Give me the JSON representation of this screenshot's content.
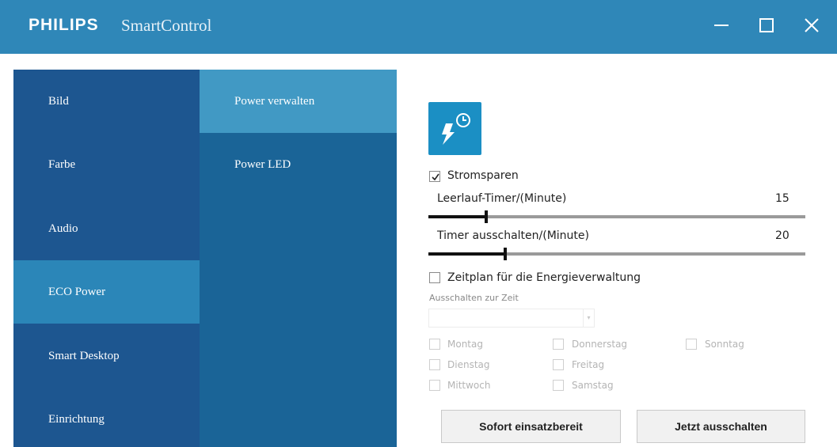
{
  "window": {
    "brand": "PHILIPS",
    "title": "SmartControl"
  },
  "nav_primary": [
    {
      "label": "Bild",
      "active": false
    },
    {
      "label": "Farbe",
      "active": false
    },
    {
      "label": "Audio",
      "active": false
    },
    {
      "label": "ECO Power",
      "active": true
    },
    {
      "label": "Smart Desktop",
      "active": false
    },
    {
      "label": "Einrichtung",
      "active": false
    }
  ],
  "nav_secondary": [
    {
      "label": "Power verwalten",
      "active": true
    },
    {
      "label": "Power LED",
      "active": false
    }
  ],
  "panel": {
    "feature_icon": "power-timer-icon",
    "power_saving": {
      "label": "Stromsparen",
      "checked": true
    },
    "idle_timer": {
      "label": "Leerlauf-Timer/(Minute)",
      "value": "15",
      "fraction": 0.153
    },
    "off_timer": {
      "label": "Timer ausschalten/(Minute)",
      "value": "20",
      "fraction": 0.203
    },
    "schedule": {
      "label": "Zeitplan für die Energieverwaltung",
      "checked": false
    },
    "off_time_label": "Ausschalten zur Zeit",
    "off_time_value": "",
    "days": [
      {
        "label": "Montag",
        "checked": false
      },
      {
        "label": "Dienstag",
        "checked": false
      },
      {
        "label": "Mittwoch",
        "checked": false
      },
      {
        "label": "Donnerstag",
        "checked": false
      },
      {
        "label": "Freitag",
        "checked": false
      },
      {
        "label": "Samstag",
        "checked": false
      },
      {
        "label": "Sonntag",
        "checked": false
      }
    ],
    "buttons": {
      "ready": "Sofort einsatzbereit",
      "shutdown": "Jetzt ausschalten"
    }
  },
  "colors": {
    "titlebar": "#2f87b8",
    "nav_primary_bg": "#1d5690",
    "nav_primary_active": "#2b86b8",
    "nav_secondary_bg": "#1a6497",
    "nav_secondary_active": "#4199c4",
    "icon_bg": "#1b8fc4"
  }
}
